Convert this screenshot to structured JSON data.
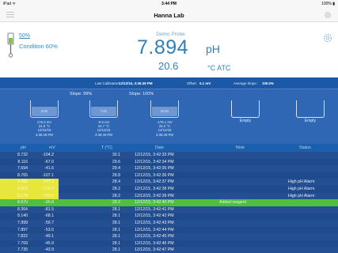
{
  "status_bar": {
    "carrier": "iPad ᯤ",
    "time": "3:44 PM",
    "battery": "100% ▮"
  },
  "nav": {
    "title": "Hanna Lab"
  },
  "reading": {
    "battery_percent": "50%",
    "condition": "Condition 60%",
    "probe_name": "Demo Probe",
    "ph_value": "7.894",
    "ph_unit": "pH",
    "temp_value": "20.6",
    "temp_unit": "°C ATC"
  },
  "calibration_info": {
    "last_label": "Last Calibration:",
    "last_value": "12/12/15, 3:36:49 PM",
    "offset_label": "Offset:",
    "offset_value": "0.1 mV",
    "avg_slope_label": "Average Slope:",
    "avg_slope_value": "100.0%"
  },
  "calibration_panel": {
    "slope1": "Slope: 99%",
    "slope2": "Slope: 100%",
    "buffers": [
      {
        "name": "4.01",
        "mv": "176.3 mV",
        "temp": "24.6 °C",
        "date": "12/12/15",
        "time": "3:36:49 PM"
      },
      {
        "name": "7.01",
        "mv": "-0.6 mV",
        "temp": "24.7 °C",
        "date": "12/12/15",
        "time": "3:36:49 PM"
      },
      {
        "name": "10.01",
        "mv": "-178.1 mV",
        "temp": "25.0 °C",
        "date": "12/12/15",
        "time": "3:36:49 PM"
      }
    ],
    "empty1": "Empty",
    "empty2": "Empty"
  },
  "log_table": {
    "headers": {
      "ph": "pH",
      "mv": "mV",
      "t": "T (°C)",
      "date": "Date",
      "note": "Note",
      "status": "Status"
    },
    "rows": [
      {
        "ph": "8.732",
        "mv": "-104.2",
        "t": "30.1",
        "date": "12/12/15, 3:42:33 PM",
        "note": "",
        "status": ""
      },
      {
        "ph": "8.116",
        "mv": "-67.0",
        "t": "29.6",
        "date": "12/12/15, 3:42:34 PM",
        "note": "",
        "status": ""
      },
      {
        "ph": "7.694",
        "mv": "-41.6",
        "t": "29.4",
        "date": "12/12/15, 3:42:35 PM",
        "note": "",
        "status": ""
      },
      {
        "ph": "8.765",
        "mv": "-107.1",
        "t": "28.8",
        "date": "12/12/15, 3:42:36 PM",
        "note": "",
        "status": ""
      },
      {
        "ph": "9.465",
        "mv": "-147.3",
        "t": "28.4",
        "date": "12/12/15, 3:42:37 PM",
        "note": "",
        "status": "High pH Alarm"
      },
      {
        "ph": "9.923",
        "mv": "-174.7",
        "t": "28.2",
        "date": "12/12/15, 3:42:38 PM",
        "note": "",
        "status": "High pH Alarm"
      },
      {
        "ph": "9.170",
        "mv": "-130.0",
        "t": "28.2",
        "date": "12/12/15, 3:42:39 PM",
        "note": "",
        "status": "High pH Alarm"
      },
      {
        "ph": "8.670",
        "mv": "-99.8",
        "t": "28.2",
        "date": "12/12/15, 3:42:40 PM",
        "note": "Added reagent",
        "status": ""
      },
      {
        "ph": "8.364",
        "mv": "-81.5",
        "t": "28.1",
        "date": "12/12/15, 3:42:41 PM",
        "note": "",
        "status": ""
      },
      {
        "ph": "8.140",
        "mv": "-68.1",
        "t": "28.1",
        "date": "12/12/15, 3:42:42 PM",
        "note": "",
        "status": ""
      },
      {
        "ph": "7.999",
        "mv": "-59.7",
        "t": "28.1",
        "date": "12/12/15, 3:42:43 PM",
        "note": "",
        "status": ""
      },
      {
        "ph": "7.897",
        "mv": "-53.5",
        "t": "28.1",
        "date": "12/12/15, 3:42:44 PM",
        "note": "",
        "status": ""
      },
      {
        "ph": "7.822",
        "mv": "-49.1",
        "t": "28.1",
        "date": "12/12/15, 3:42:45 PM",
        "note": "",
        "status": ""
      },
      {
        "ph": "7.769",
        "mv": "-45.9",
        "t": "28.1",
        "date": "12/12/15, 3:42:46 PM",
        "note": "",
        "status": ""
      },
      {
        "ph": "7.735",
        "mv": "-43.9",
        "t": "28.1",
        "date": "12/12/15, 3:42:47 PM",
        "note": "",
        "status": ""
      }
    ]
  }
}
